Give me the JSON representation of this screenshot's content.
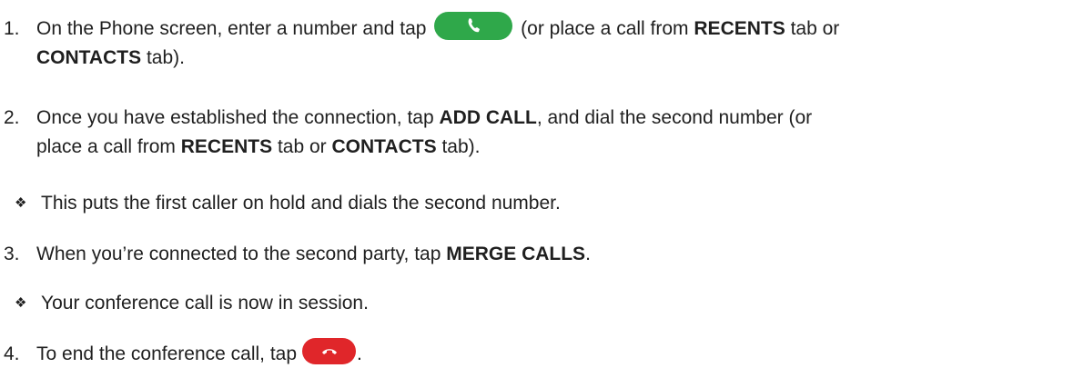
{
  "steps": [
    {
      "num": "1.",
      "t1": "On the Phone screen, enter a number and tap",
      "t2": "(or place a call from",
      "b1": "RECENTS",
      "t3": "tab or",
      "b2": "CONTACTS",
      "t4": "tab)."
    },
    {
      "num": "2.",
      "t1": "Once you have established the connection, tap",
      "b1": "ADD CALL",
      "t2": ", and dial the second number (or",
      "t3": "place a call from",
      "b2": "RECENTS",
      "t4": "tab or",
      "b3": "CONTACTS",
      "t5": "tab)."
    },
    {
      "num": "3.",
      "t1": "When you’re connected to the second party, tap",
      "b1": "MERGE CALLS",
      "t2": "."
    },
    {
      "num": "4.",
      "t1": "To end the conference call, tap",
      "t2": "."
    }
  ],
  "bullets": [
    {
      "mark": "❖",
      "text": "This puts the first caller on hold and dials the second number."
    },
    {
      "mark": "❖",
      "text": "Your conference call is now in session."
    }
  ],
  "icons": {
    "call_button": "phone-call-icon",
    "end_button": "phone-hangup-icon",
    "call_color": "#2fa84a",
    "end_color": "#e0262a"
  }
}
